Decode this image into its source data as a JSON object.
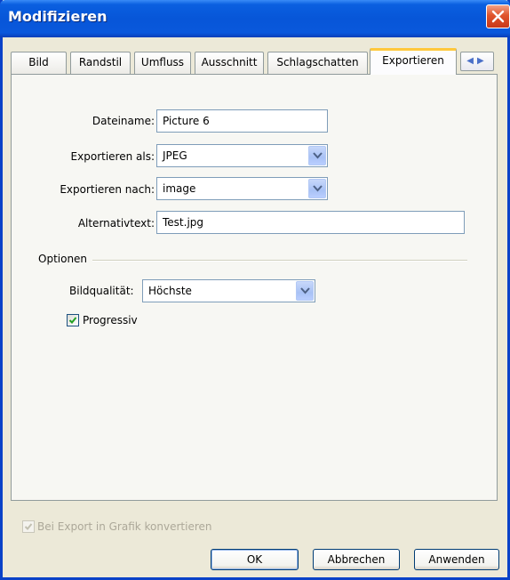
{
  "window": {
    "title": "Modifizieren"
  },
  "tabs": [
    {
      "label": "Bild"
    },
    {
      "label": "Randstil"
    },
    {
      "label": "Umfluss"
    },
    {
      "label": "Ausschnitt"
    },
    {
      "label": "Schlagschatten"
    },
    {
      "label": "Exportieren",
      "active": true
    }
  ],
  "tab_scroll": {
    "left": "◀",
    "right": "▶"
  },
  "form": {
    "filename_label": "Dateiname:",
    "filename_value": "Picture 6",
    "export_as_label": "Exportieren als:",
    "export_as_value": "JPEG",
    "export_to_label": "Exportieren nach:",
    "export_to_value": "image",
    "alt_text_label": "Alternativtext:",
    "alt_text_value": "Test.jpg"
  },
  "options": {
    "group_title": "Optionen",
    "quality_label": "Bildqualität:",
    "quality_value": "Höchste",
    "progressive_label": "Progressiv",
    "progressive_checked": true
  },
  "footer": {
    "convert_label": "Bei Export in Grafik konvertieren",
    "convert_checked": true,
    "convert_enabled": false,
    "ok_label": "OK",
    "cancel_label": "Abbrechen",
    "apply_label": "Anwenden"
  },
  "colors": {
    "titlebar": "#0756d8",
    "active_tab_accent": "#ffc83c",
    "close_button": "#e0542b",
    "dialog_bg": "#ece9d8"
  }
}
